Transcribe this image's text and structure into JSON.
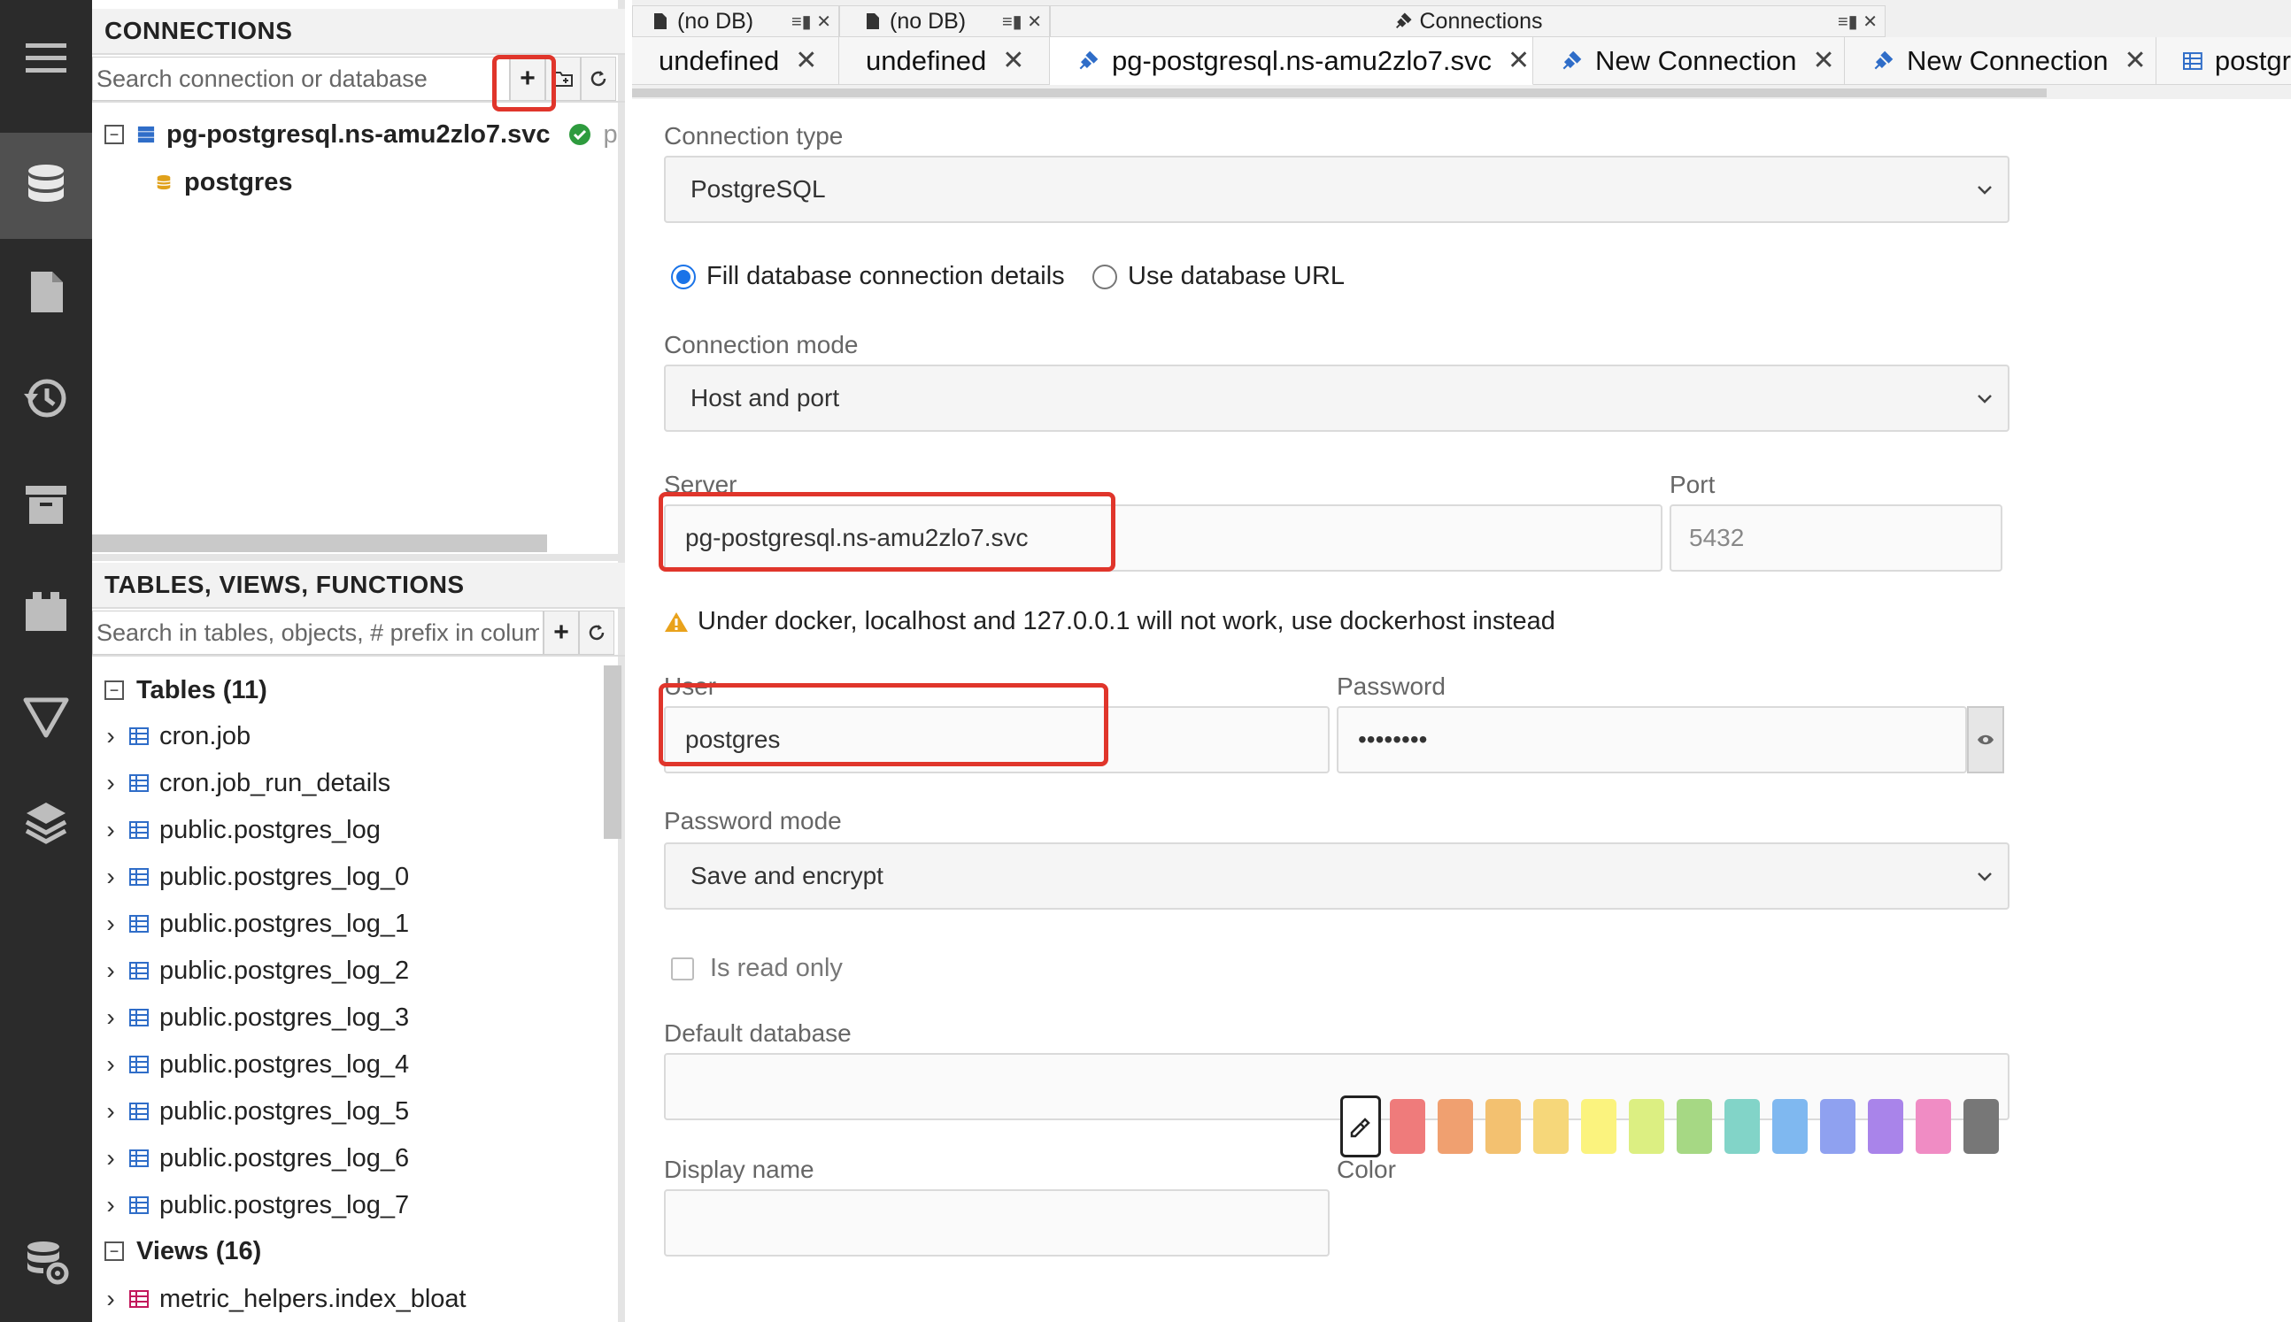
{
  "rail": {
    "items": [
      "menu",
      "database",
      "file",
      "history",
      "archive",
      "plugin",
      "filter",
      "layers",
      "database-settings"
    ]
  },
  "connections": {
    "title": "CONNECTIONS",
    "search_placeholder": "Search connection or database",
    "tree": {
      "server": "pg-postgresql.ns-amu2zlo7.svc",
      "server_suffix": "p",
      "database": "postgres"
    }
  },
  "objects": {
    "title": "TABLES, VIEWS, FUNCTIONS",
    "search_placeholder": "Search in tables, objects, # prefix in colum",
    "tables_header": "Tables (11)",
    "tables": [
      "cron.job",
      "cron.job_run_details",
      "public.postgres_log",
      "public.postgres_log_0",
      "public.postgres_log_1",
      "public.postgres_log_2",
      "public.postgres_log_3",
      "public.postgres_log_4",
      "public.postgres_log_5",
      "public.postgres_log_6",
      "public.postgres_log_7"
    ],
    "views_header": "Views (16)",
    "views": [
      "metric_helpers.index_bloat"
    ]
  },
  "top_tabs": {
    "groups": [
      "(no DB)",
      "(no DB)",
      "Connections"
    ],
    "tabs": [
      {
        "label": "undefined"
      },
      {
        "label": "undefined"
      },
      {
        "label": "pg-postgresql.ns-amu2zlo7.svc"
      },
      {
        "label": "New Connection"
      },
      {
        "label": "New Connection"
      },
      {
        "label": "postgr"
      }
    ],
    "close_glyph": "✕"
  },
  "form": {
    "connection_type_label": "Connection type",
    "connection_type_value": "PostgreSQL",
    "radio_fill": "Fill database connection details",
    "radio_url": "Use database URL",
    "connection_mode_label": "Connection mode",
    "connection_mode_value": "Host and port",
    "server_label": "Server",
    "server_value": "pg-postgresql.ns-amu2zlo7.svc",
    "port_label": "Port",
    "port_value": "5432",
    "warning": "Under docker, localhost and 127.0.0.1 will not work, use dockerhost instead",
    "user_label": "User",
    "user_value": "postgres",
    "password_label": "Password",
    "password_value": "••••••••",
    "password_mode_label": "Password mode",
    "password_mode_value": "Save and encrypt",
    "readonly_label": "Is read only",
    "default_db_label": "Default database",
    "default_db_value": "",
    "display_name_label": "Display name",
    "display_name_value": "",
    "color_label": "Color",
    "colors": [
      "#ef7b7b",
      "#f0a070",
      "#f3c170",
      "#f6d77a",
      "#fbf37e",
      "#dcef82",
      "#a6d884",
      "#82d4c8",
      "#7fb8f0",
      "#8fa1f0",
      "#a984ea",
      "#f08cc4",
      "#777777"
    ]
  },
  "colors": {
    "accent": "#1a73e8",
    "highlight": "#e0352b",
    "rail_bg": "#2b2b2b"
  }
}
